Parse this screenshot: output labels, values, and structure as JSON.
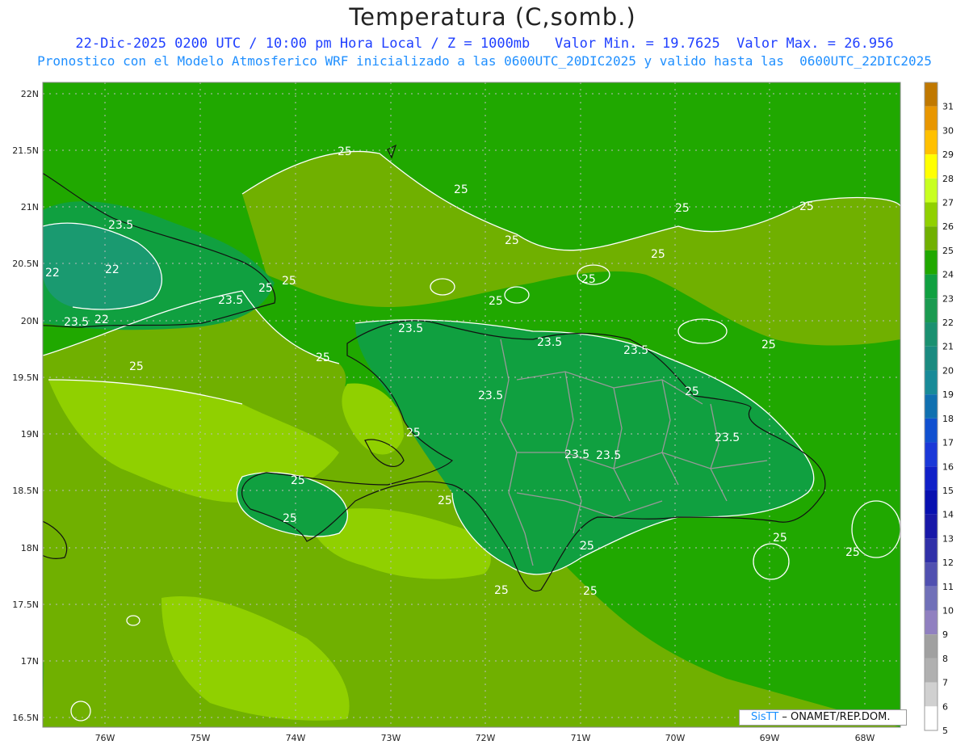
{
  "header": {
    "title": "Temperatura (C,somb.)",
    "line1": "22-Dic-2025 0200 UTC / 10:00 pm Hora Local / Z = 1000mb   Valor Min. = 19.7625  Valor Max. = 26.956",
    "line2": "Pronostico con el Modelo Atmosferico WRF inicializado a las 0600UTC_20DIC2025 y valido hasta las  0600UTC_22DIC2025"
  },
  "axes": {
    "lat_labels": [
      "22N",
      "21.5N",
      "21N",
      "20.5N",
      "20N",
      "19.5N",
      "19N",
      "18.5N",
      "18N",
      "17.5N",
      "17N",
      "16.5N"
    ],
    "lon_labels": [
      "76W",
      "75W",
      "74W",
      "73W",
      "72W",
      "71W",
      "70W",
      "69W",
      "68W"
    ]
  },
  "colorbar": {
    "levels": [
      "31",
      "30",
      "29",
      "28",
      "27",
      "26",
      "25",
      "24",
      "23",
      "22",
      "21",
      "20",
      "19",
      "18",
      "17",
      "16",
      "15",
      "14",
      "13",
      "12",
      "11",
      "10",
      "9",
      "8",
      "7",
      "6",
      "5"
    ],
    "colors": [
      "#c07800",
      "#e89600",
      "#ffc000",
      "#ffff00",
      "#c8ff20",
      "#90d000",
      "#70b000",
      "#20a800",
      "#10a040",
      "#1a9a50",
      "#1a9070",
      "#1a8a80",
      "#188a98",
      "#1070b0",
      "#1050d0",
      "#1a38d8",
      "#1020c8",
      "#0810b0",
      "#1818a8",
      "#3030a8",
      "#5050b0",
      "#7070b8",
      "#9080c0",
      "#a0a0a0",
      "#b0b0b0",
      "#d0d0d0",
      "#ffffff"
    ]
  },
  "map": {
    "ocean_color": "#20a800",
    "warm_color": "#70b000",
    "warmer_color": "#90d000",
    "cool_color": "#10a040",
    "coolest_color": "#1a9a70",
    "contour_labels": [
      "25",
      "25",
      "25",
      "23.5",
      "22",
      "22",
      "22",
      "23.5",
      "25",
      "25",
      "25",
      "25",
      "25",
      "25",
      "25",
      "25",
      "23.5",
      "23.5",
      "23.5",
      "23.5",
      "25",
      "23.5",
      "25",
      "25",
      "23.5",
      "23.5",
      "25",
      "25",
      "25",
      "23.5",
      "25",
      "25",
      "25",
      "25",
      "25",
      "25"
    ]
  },
  "credit": {
    "brand": "SisTT",
    "text": " – ONAMET/REP.DOM."
  }
}
